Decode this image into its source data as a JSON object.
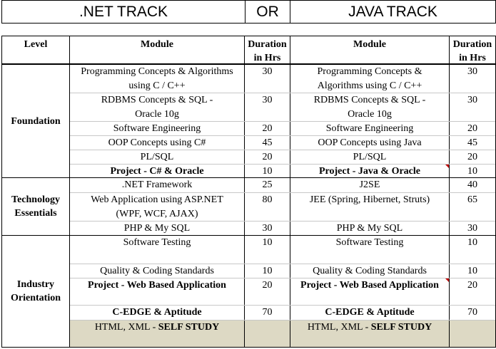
{
  "header": {
    "left_track": ".NET TRACK",
    "or_label": "OR",
    "right_track": "JAVA TRACK"
  },
  "columns": {
    "level": "Level",
    "module": "Module",
    "duration_line1": "Duration",
    "duration_line2": "in Hrs"
  },
  "levels": {
    "foundation": "Foundation",
    "tech_line1": "Technology",
    "tech_line2": "Essentials",
    "industry_line1": "Industry",
    "industry_line2": "Orientation"
  },
  "rows": [
    {
      "net_l1": "Programming Concepts & Algorithms",
      "net_l2": "using C / C++",
      "net_hrs": "30",
      "java_l1": "Programming Concepts &",
      "java_l2": "Algorithms using C / C++",
      "java_hrs": "30"
    },
    {
      "net_l1": "RDBMS Concepts & SQL -",
      "net_l2": "Oracle 10g",
      "net_hrs": "30",
      "java_l1": "RDBMS Concepts & SQL -",
      "java_l2": "Oracle 10g",
      "java_hrs": "30"
    },
    {
      "net_l1": "Software Engineering",
      "net_hrs": "20",
      "java_l1": "Software Engineering",
      "java_hrs": "20"
    },
    {
      "net_l1": "OOP Concepts using C#",
      "net_hrs": "45",
      "java_l1": "OOP Concepts using Java",
      "java_hrs": "45"
    },
    {
      "net_l1": "PL/SQL",
      "net_hrs": "20",
      "java_l1": "PL/SQL",
      "java_hrs": "20"
    },
    {
      "net_l1": "Project - C# & Oracle",
      "net_hrs": "10",
      "java_l1": "Project - Java & Oracle",
      "java_hrs": "10"
    },
    {
      "net_l1": ".NET Framework",
      "net_hrs": "25",
      "java_l1": "J2SE",
      "java_hrs": "40"
    },
    {
      "net_l1": "Web Application using ASP.NET",
      "net_l2": "(WPF, WCF, AJAX)",
      "net_hrs": "80",
      "java_l1": "JEE (Spring, Hibernet, Struts)",
      "java_hrs": "65"
    },
    {
      "net_l1": "PHP & My SQL",
      "net_hrs": "30",
      "java_l1": "PHP & My SQL",
      "java_hrs": "30"
    },
    {
      "net_l1": "Software Testing",
      "net_hrs": "10",
      "java_l1": "Software Testing",
      "java_hrs": "10"
    },
    {
      "net_l1": "Quality & Coding Standards",
      "net_hrs": "10",
      "java_l1": "Quality & Coding Standards",
      "java_hrs": "10"
    },
    {
      "net_l1": "Project - Web Based Application",
      "net_hrs": "20",
      "java_l1": "Project - Web Based Application",
      "java_hrs": "20"
    },
    {
      "net_l1": "C-EDGE & Aptitude",
      "net_hrs": "70",
      "java_l1": "C-EDGE & Aptitude",
      "java_hrs": "70"
    }
  ],
  "self_study": {
    "net_prefix": "HTML, XML - ",
    "net_bold": "SELF STUDY",
    "java_prefix": "HTML, XML - ",
    "java_bold": "SELF STUDY"
  },
  "colors": {
    "self_study_fill": "#ddd9c4",
    "comment_marker": "#c00000"
  }
}
